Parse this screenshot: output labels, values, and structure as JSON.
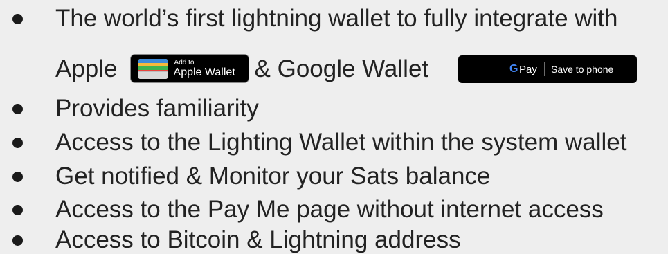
{
  "bullets": [
    "The world’s first lightning wallet to fully integrate with",
    "Provides familiarity",
    "Access to the Lighting Wallet within the system wallet",
    "Get notified & Monitor your Sats balance",
    "Access to the Pay Me page without internet access",
    "Access to Bitcoin & Lightning address"
  ],
  "line2": {
    "before_badge": "Apple",
    "after_badge": "& Google Wallet"
  },
  "apple_badge": {
    "small_text": "Add to",
    "big_text": "Apple Wallet"
  },
  "google_badge": {
    "g": "G",
    "pay": "Pay",
    "save": "Save to phone"
  }
}
